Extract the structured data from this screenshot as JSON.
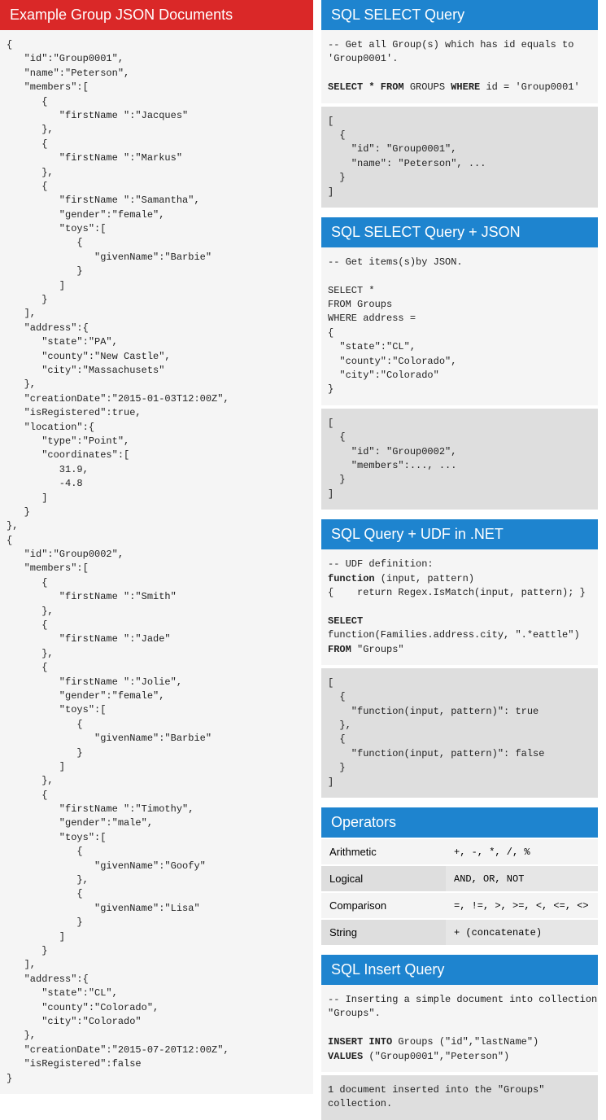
{
  "left": {
    "header": "Example Group JSON Documents",
    "code": "{\n   \"id\":\"Group0001\",\n   \"name\":\"Peterson\",\n   \"members\":[\n      {\n         \"firstName \":\"Jacques\"\n      },\n      {\n         \"firstName \":\"Markus\"\n      },\n      {\n         \"firstName \":\"Samantha\",\n         \"gender\":\"female\",\n         \"toys\":[\n            {\n               \"givenName\":\"Barbie\"\n            }\n         ]\n      }\n   ],\n   \"address\":{\n      \"state\":\"PA\",\n      \"county\":\"New Castle\",\n      \"city\":\"Massachusets\"\n   },\n   \"creationDate\":\"2015-01-03T12:00Z\",\n   \"isRegistered\":true,\n   \"location\":{\n      \"type\":\"Point\",\n      \"coordinates\":[\n         31.9,\n         -4.8\n      ]\n   }\n},\n{\n   \"id\":\"Group0002\",\n   \"members\":[\n      {\n         \"firstName \":\"Smith\"\n      },\n      {\n         \"firstName \":\"Jade\"\n      },\n      {\n         \"firstName \":\"Jolie\",\n         \"gender\":\"female\",\n         \"toys\":[\n            {\n               \"givenName\":\"Barbie\"\n            }\n         ]\n      },\n      {\n         \"firstName \":\"Timothy\",\n         \"gender\":\"male\",\n         \"toys\":[\n            {\n               \"givenName\":\"Goofy\"\n            },\n            {\n               \"givenName\":\"Lisa\"\n            }\n         ]\n      }\n   ],\n   \"address\":{\n      \"state\":\"CL\",\n      \"county\":\"Colorado\",\n      \"city\":\"Colorado\"\n   },\n   \"creationDate\":\"2015-07-20T12:00Z\",\n   \"isRegistered\":false\n}"
  },
  "cards": {
    "select": {
      "header": "SQL SELECT Query",
      "query_comment": "-- Get all Group(s) which has id equals to\n'Group0001'.",
      "query_line_html": "<span class=\"bold\">SELECT * FROM</span> GROUPS <span class=\"bold\">WHERE</span> id = 'Group0001'",
      "result": "[\n  {\n    \"id\": \"Group0001\",\n    \"name\": \"Peterson\", ...\n  }\n]"
    },
    "select_json": {
      "header": "SQL SELECT Query + JSON",
      "query": "-- Get items(s)by JSON.\n\nSELECT *\nFROM Groups\nWHERE address =\n{\n  \"state\":\"CL\",\n  \"county\":\"Colorado\",\n  \"city\":\"Colorado\"\n}",
      "result": "[\n  {\n    \"id\": \"Group0002\",\n    \"members\":..., ...\n  }\n]"
    },
    "udf": {
      "header": "SQL Query + UDF in .NET",
      "query_html": "-- UDF definition:\n<span class=\"bold\">function</span> (input, pattern)\n{    return Regex.IsMatch(input, pattern); }\n\n<span class=\"bold\">SELECT</span>\nfunction(Families.address.city, \".*eattle\")\n<span class=\"bold\">FROM</span> \"Groups\"",
      "result": "[\n  {\n    \"function(input, pattern)\": true\n  },\n  {\n    \"function(input, pattern)\": false\n  }\n]"
    },
    "operators": {
      "header": "Operators",
      "rows": [
        {
          "label": "Arithmetic",
          "val": "+, -, *, /, %"
        },
        {
          "label": "Logical",
          "val": "AND, OR, NOT"
        },
        {
          "label": "Comparison",
          "val": "=, !=, >, >=, <, <=, <>"
        },
        {
          "label": "String",
          "val": "+ (concatenate)"
        }
      ]
    },
    "insert": {
      "header": "SQL Insert Query",
      "query_html": "-- Inserting a simple document into collection\n\"Groups\".\n\n<span class=\"bold\">INSERT INTO</span> Groups (\"id\",\"lastName\")\n<span class=\"bold\">VALUES</span> (\"Group0001\",\"Peterson\")",
      "result": "1 document inserted into the \"Groups\"\ncollection."
    }
  }
}
